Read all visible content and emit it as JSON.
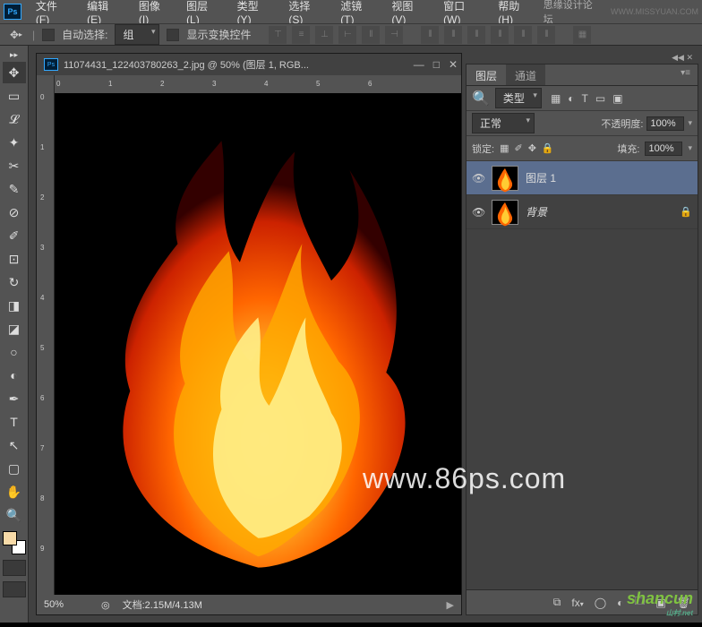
{
  "menu": {
    "items": [
      "文件(F)",
      "编辑(E)",
      "图像(I)",
      "图层(L)",
      "类型(Y)",
      "选择(S)",
      "滤镜(T)",
      "视图(V)",
      "窗口(W)",
      "帮助(H)"
    ],
    "right_text": "思缘设计论坛",
    "right_url": "WWW.MISSYUAN.COM"
  },
  "optbar": {
    "auto_select": "自动选择:",
    "group": "组",
    "show_transform": "显示变换控件"
  },
  "doc": {
    "title": "11074431_122403780263_2.jpg @ 50% (图层 1, RGB...",
    "zoom": "50%",
    "status_label": "文档:",
    "status_value": "2.15M/4.13M",
    "ruler_h": [
      "0",
      "1",
      "2",
      "3",
      "4",
      "5",
      "6"
    ],
    "ruler_v": [
      "0",
      "1",
      "2",
      "3",
      "4",
      "5",
      "6",
      "7",
      "8",
      "9"
    ]
  },
  "panel": {
    "tabs": [
      "图层",
      "通道"
    ],
    "filter_label": "类型",
    "blend_mode": "正常",
    "opacity_label": "不透明度:",
    "opacity_value": "100%",
    "lock_label": "锁定:",
    "fill_label": "填充:",
    "fill_value": "100%",
    "layers": [
      {
        "name": "图层 1",
        "selected": true,
        "locked": false
      },
      {
        "name": "背景",
        "selected": false,
        "locked": true
      }
    ]
  },
  "watermark1": "www.86ps.com",
  "watermark2": "shancun",
  "watermark2_sub": "山村.net"
}
